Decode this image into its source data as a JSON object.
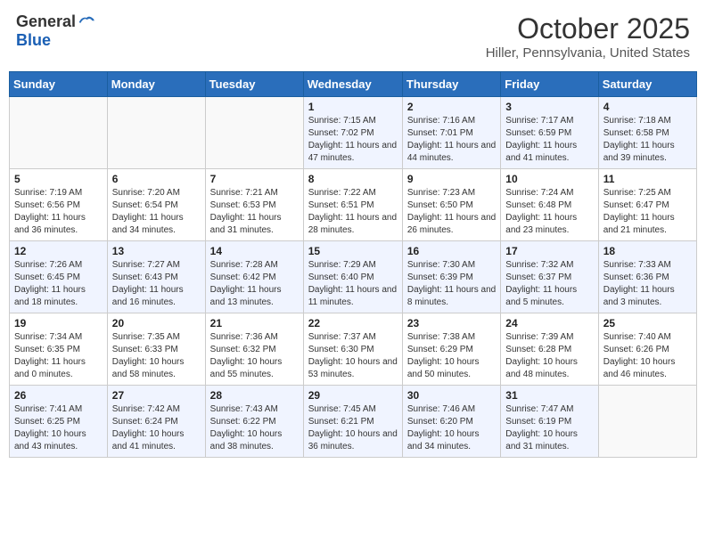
{
  "header": {
    "logo_general": "General",
    "logo_blue": "Blue",
    "month": "October 2025",
    "location": "Hiller, Pennsylvania, United States"
  },
  "days_of_week": [
    "Sunday",
    "Monday",
    "Tuesday",
    "Wednesday",
    "Thursday",
    "Friday",
    "Saturday"
  ],
  "weeks": [
    [
      {
        "day": "",
        "sunrise": "",
        "sunset": "",
        "daylight": ""
      },
      {
        "day": "",
        "sunrise": "",
        "sunset": "",
        "daylight": ""
      },
      {
        "day": "",
        "sunrise": "",
        "sunset": "",
        "daylight": ""
      },
      {
        "day": "1",
        "sunrise": "Sunrise: 7:15 AM",
        "sunset": "Sunset: 7:02 PM",
        "daylight": "Daylight: 11 hours and 47 minutes."
      },
      {
        "day": "2",
        "sunrise": "Sunrise: 7:16 AM",
        "sunset": "Sunset: 7:01 PM",
        "daylight": "Daylight: 11 hours and 44 minutes."
      },
      {
        "day": "3",
        "sunrise": "Sunrise: 7:17 AM",
        "sunset": "Sunset: 6:59 PM",
        "daylight": "Daylight: 11 hours and 41 minutes."
      },
      {
        "day": "4",
        "sunrise": "Sunrise: 7:18 AM",
        "sunset": "Sunset: 6:58 PM",
        "daylight": "Daylight: 11 hours and 39 minutes."
      }
    ],
    [
      {
        "day": "5",
        "sunrise": "Sunrise: 7:19 AM",
        "sunset": "Sunset: 6:56 PM",
        "daylight": "Daylight: 11 hours and 36 minutes."
      },
      {
        "day": "6",
        "sunrise": "Sunrise: 7:20 AM",
        "sunset": "Sunset: 6:54 PM",
        "daylight": "Daylight: 11 hours and 34 minutes."
      },
      {
        "day": "7",
        "sunrise": "Sunrise: 7:21 AM",
        "sunset": "Sunset: 6:53 PM",
        "daylight": "Daylight: 11 hours and 31 minutes."
      },
      {
        "day": "8",
        "sunrise": "Sunrise: 7:22 AM",
        "sunset": "Sunset: 6:51 PM",
        "daylight": "Daylight: 11 hours and 28 minutes."
      },
      {
        "day": "9",
        "sunrise": "Sunrise: 7:23 AM",
        "sunset": "Sunset: 6:50 PM",
        "daylight": "Daylight: 11 hours and 26 minutes."
      },
      {
        "day": "10",
        "sunrise": "Sunrise: 7:24 AM",
        "sunset": "Sunset: 6:48 PM",
        "daylight": "Daylight: 11 hours and 23 minutes."
      },
      {
        "day": "11",
        "sunrise": "Sunrise: 7:25 AM",
        "sunset": "Sunset: 6:47 PM",
        "daylight": "Daylight: 11 hours and 21 minutes."
      }
    ],
    [
      {
        "day": "12",
        "sunrise": "Sunrise: 7:26 AM",
        "sunset": "Sunset: 6:45 PM",
        "daylight": "Daylight: 11 hours and 18 minutes."
      },
      {
        "day": "13",
        "sunrise": "Sunrise: 7:27 AM",
        "sunset": "Sunset: 6:43 PM",
        "daylight": "Daylight: 11 hours and 16 minutes."
      },
      {
        "day": "14",
        "sunrise": "Sunrise: 7:28 AM",
        "sunset": "Sunset: 6:42 PM",
        "daylight": "Daylight: 11 hours and 13 minutes."
      },
      {
        "day": "15",
        "sunrise": "Sunrise: 7:29 AM",
        "sunset": "Sunset: 6:40 PM",
        "daylight": "Daylight: 11 hours and 11 minutes."
      },
      {
        "day": "16",
        "sunrise": "Sunrise: 7:30 AM",
        "sunset": "Sunset: 6:39 PM",
        "daylight": "Daylight: 11 hours and 8 minutes."
      },
      {
        "day": "17",
        "sunrise": "Sunrise: 7:32 AM",
        "sunset": "Sunset: 6:37 PM",
        "daylight": "Daylight: 11 hours and 5 minutes."
      },
      {
        "day": "18",
        "sunrise": "Sunrise: 7:33 AM",
        "sunset": "Sunset: 6:36 PM",
        "daylight": "Daylight: 11 hours and 3 minutes."
      }
    ],
    [
      {
        "day": "19",
        "sunrise": "Sunrise: 7:34 AM",
        "sunset": "Sunset: 6:35 PM",
        "daylight": "Daylight: 11 hours and 0 minutes."
      },
      {
        "day": "20",
        "sunrise": "Sunrise: 7:35 AM",
        "sunset": "Sunset: 6:33 PM",
        "daylight": "Daylight: 10 hours and 58 minutes."
      },
      {
        "day": "21",
        "sunrise": "Sunrise: 7:36 AM",
        "sunset": "Sunset: 6:32 PM",
        "daylight": "Daylight: 10 hours and 55 minutes."
      },
      {
        "day": "22",
        "sunrise": "Sunrise: 7:37 AM",
        "sunset": "Sunset: 6:30 PM",
        "daylight": "Daylight: 10 hours and 53 minutes."
      },
      {
        "day": "23",
        "sunrise": "Sunrise: 7:38 AM",
        "sunset": "Sunset: 6:29 PM",
        "daylight": "Daylight: 10 hours and 50 minutes."
      },
      {
        "day": "24",
        "sunrise": "Sunrise: 7:39 AM",
        "sunset": "Sunset: 6:28 PM",
        "daylight": "Daylight: 10 hours and 48 minutes."
      },
      {
        "day": "25",
        "sunrise": "Sunrise: 7:40 AM",
        "sunset": "Sunset: 6:26 PM",
        "daylight": "Daylight: 10 hours and 46 minutes."
      }
    ],
    [
      {
        "day": "26",
        "sunrise": "Sunrise: 7:41 AM",
        "sunset": "Sunset: 6:25 PM",
        "daylight": "Daylight: 10 hours and 43 minutes."
      },
      {
        "day": "27",
        "sunrise": "Sunrise: 7:42 AM",
        "sunset": "Sunset: 6:24 PM",
        "daylight": "Daylight: 10 hours and 41 minutes."
      },
      {
        "day": "28",
        "sunrise": "Sunrise: 7:43 AM",
        "sunset": "Sunset: 6:22 PM",
        "daylight": "Daylight: 10 hours and 38 minutes."
      },
      {
        "day": "29",
        "sunrise": "Sunrise: 7:45 AM",
        "sunset": "Sunset: 6:21 PM",
        "daylight": "Daylight: 10 hours and 36 minutes."
      },
      {
        "day": "30",
        "sunrise": "Sunrise: 7:46 AM",
        "sunset": "Sunset: 6:20 PM",
        "daylight": "Daylight: 10 hours and 34 minutes."
      },
      {
        "day": "31",
        "sunrise": "Sunrise: 7:47 AM",
        "sunset": "Sunset: 6:19 PM",
        "daylight": "Daylight: 10 hours and 31 minutes."
      },
      {
        "day": "",
        "sunrise": "",
        "sunset": "",
        "daylight": ""
      }
    ]
  ]
}
